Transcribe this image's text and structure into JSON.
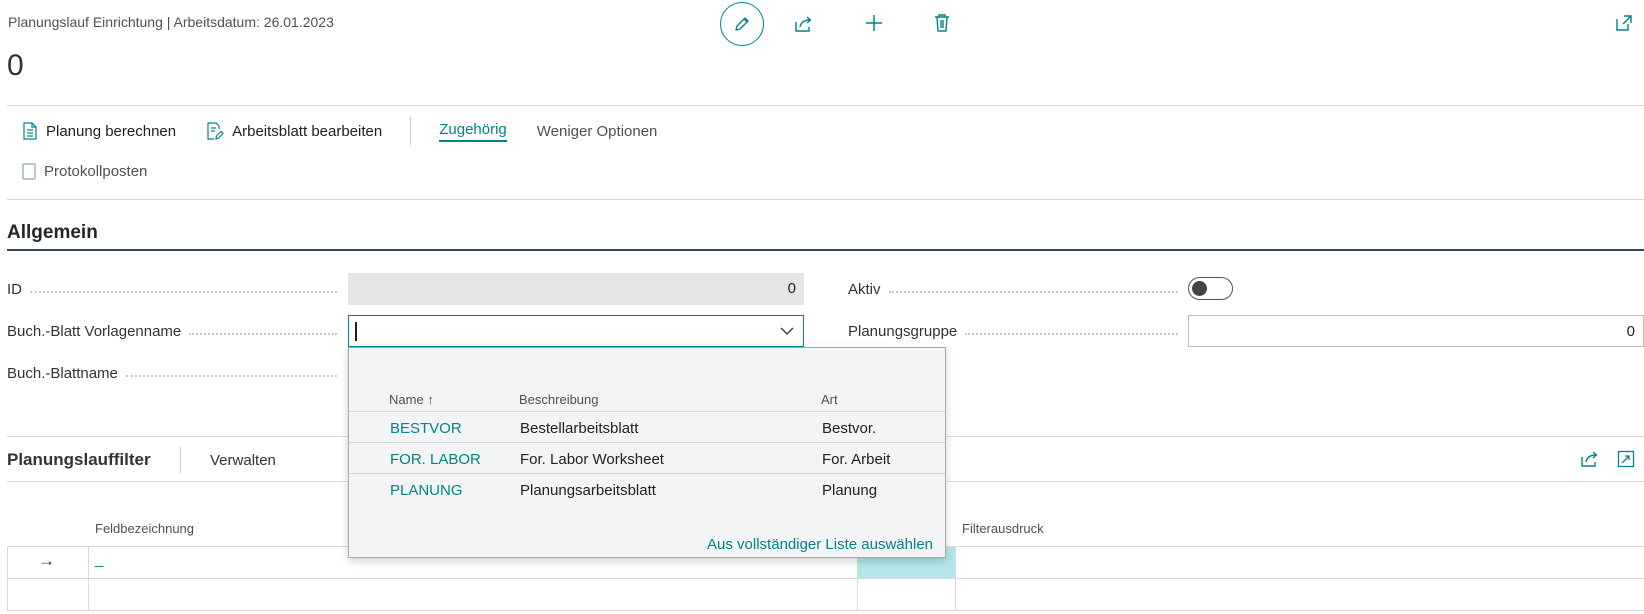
{
  "header": {
    "caption": "Planungslauf Einrichtung | Arbeitsdatum: 26.01.2023",
    "record_title": "0"
  },
  "toolbar": {
    "edit_icon": "pencil-icon",
    "share_icon": "share-icon",
    "new_icon": "plus-icon",
    "delete_icon": "trash-icon",
    "popout_icon": "popout-icon"
  },
  "actions": {
    "calc_planning": "Planung berechnen",
    "edit_worksheet": "Arbeitsblatt bearbeiten",
    "related": "Zugehörig",
    "fewer_options": "Weniger Optionen",
    "log_entries": "Protokollposten"
  },
  "general": {
    "section_title": "Allgemein",
    "id_label": "ID",
    "id_value": "0",
    "template_label": "Buch.-Blatt Vorlagenname",
    "template_value": "",
    "batch_label": "Buch.-Blattname",
    "active_label": "Aktiv",
    "active_value": false,
    "group_label": "Planungsgruppe",
    "group_value": "0"
  },
  "dropdown": {
    "col_name": "Name",
    "sort_indicator": "↑",
    "col_desc": "Beschreibung",
    "col_type": "Art",
    "rows": [
      {
        "name": "BESTVOR",
        "desc": "Bestellarbeitsblatt",
        "type": "Bestvor."
      },
      {
        "name": "FOR. LABOR",
        "desc": "For. Labor Worksheet",
        "type": "For. Arbeit"
      },
      {
        "name": "PLANUNG",
        "desc": "Planungsarbeitsblatt",
        "type": "Planung"
      }
    ],
    "footer": "Aus vollständiger Liste auswählen"
  },
  "filter": {
    "title": "Planungslauffilter",
    "manage": "Verwalten",
    "col_field": "Feldbezeichnung",
    "col_expr": "Filterausdruck",
    "row_arrow": "→",
    "row_value": "_"
  },
  "colors": {
    "accent": "#00838a",
    "highlight_cell": "#b2e6e8"
  }
}
